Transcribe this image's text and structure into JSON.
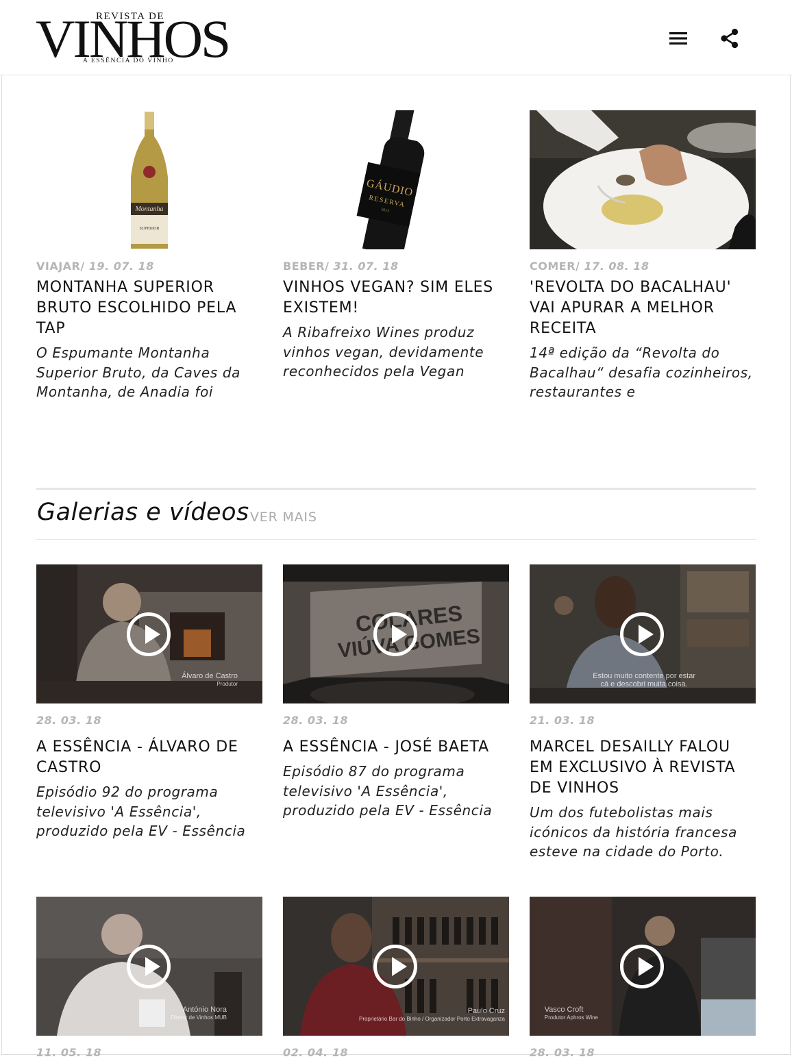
{
  "header": {
    "logo_top": "REVISTA DE",
    "logo_main": "VINHOS",
    "logo_sub": "A ESSÊNCIA DO VINHO",
    "menu_icon": "menu-icon",
    "share_icon": "share-icon"
  },
  "articles": [
    {
      "category": "VIAJAR/",
      "date": "19. 07. 18",
      "title": "MONTANHA SUPERIOR BRUTO ESCOLHIDO PELA TAP",
      "excerpt": "O Espumante Montanha Superior Bruto, da Caves da Montanha, de Anadia foi",
      "label": "Montanha",
      "label_sub": "SUPERIOR"
    },
    {
      "category": "BEBER/",
      "date": "31. 07. 18",
      "title": "VINHOS VEGAN? SIM ELES EXISTEM!",
      "excerpt": "A Ribafreixo Wines produz vinhos vegan, devidamente reconhecidos pela Vegan",
      "label": "GÁUDIO",
      "label_sub": "RESERVA",
      "label_year": "2013"
    },
    {
      "category": "COMER/",
      "date": "17. 08. 18",
      "title": "'REVOLTA DO BACALHAU' VAI APURAR A MELHOR RECEITA",
      "excerpt": "14ª edição da “Revolta do Bacalhau“ desafia cozinheiros, restaurantes e"
    }
  ],
  "gallery": {
    "title": "Galerias e vídeos",
    "see_more": "VER MAIS",
    "videos": [
      {
        "date": "28. 03. 18",
        "title": "A ESSÊNCIA - ÁLVARO DE CASTRO",
        "excerpt": "Episódio 92 do programa televisivo 'A Essência', produzido pela EV - Essência",
        "caption": "Álvaro de Castro",
        "caption_sub": "Produtor"
      },
      {
        "date": "28. 03. 18",
        "title": "A ESSÊNCIA - JOSÉ BAETA",
        "excerpt": "Episódio 87 do programa televisivo 'A Essência', produzido pela EV - Essência",
        "wall_text_1": "COLARES",
        "wall_text_2": "VIÚVA GOMES"
      },
      {
        "date": "21. 03. 18",
        "title": "MARCEL DESAILLY FALOU EM EXCLUSIVO À REVISTA DE VINHOS",
        "excerpt": "Um dos futebolistas mais icónicos da história francesa esteve na cidade do Porto.",
        "caption": "Estou muito contente por estar",
        "caption_sub": "cá e descobri muita coisa."
      },
      {
        "date": "11. 05. 18",
        "caption": "António Nora",
        "caption_sub": "Diretor de Vinhos MUB"
      },
      {
        "date": "02. 04. 18",
        "caption": "Paulo Cruz",
        "caption_sub": "Proprietário Bar do Binho / Organizador Porto Extravaganza"
      },
      {
        "date": "28. 03. 18",
        "caption": "Vasco Croft",
        "caption_sub": "Produtor Aphros Wine"
      }
    ]
  },
  "colors": {
    "meta_gray": "#b5b5b5",
    "rule_gray": "#e6e6e6",
    "text": "#111111"
  }
}
